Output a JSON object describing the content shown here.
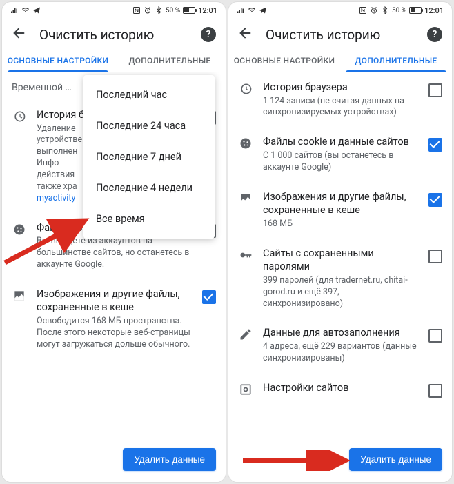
{
  "status": {
    "battery_pct": "50 %",
    "time": "12:01"
  },
  "header": {
    "title": "Очистить историю",
    "help": "?"
  },
  "tabs": {
    "basic": "ОСНОВНЫЕ НАСТРОЙКИ",
    "advanced": "ДОПОЛНИТЕЛЬНЫЕ"
  },
  "left": {
    "time_range_label": "Временной д…",
    "time_range_value": "Последний час",
    "menu": [
      "Последний час",
      "Последние 24 часа",
      "Последние 7 дней",
      "Последние 4 недели",
      "Все время"
    ],
    "items": [
      {
        "title": "История браузера",
        "sub_pre": "Удаление\nустройстве\nвыполнен\nИнфо\nдействия\nтакже хра\n",
        "sub_link": "myactivity",
        "checked": false
      },
      {
        "title": "Файлы cookie и данные сайтов",
        "sub": "Вы выйдете из аккаунтов на большинстве сайтов, но останетесь в аккаунте Google.",
        "checked": false
      },
      {
        "title": "Изображения и другие файлы, сохраненные в кеше",
        "sub": "Освободится 168 МБ пространства. После этого некоторые веб-страницы могут загружаться дольше обычного.",
        "checked": true
      }
    ]
  },
  "right": {
    "items": [
      {
        "title": "История браузера",
        "sub": "1 124 записи (не считая данных на синхронизируемых устройствах)",
        "checked": false
      },
      {
        "title": "Файлы cookie и данные сайтов",
        "sub": "С 1 000 сайтов (вы останетесь в аккаунте Google)",
        "checked": true
      },
      {
        "title": "Изображения и другие файлы, сохраненные в кеше",
        "sub": "168 МБ",
        "checked": true
      },
      {
        "title": "Сайты с сохраненными паролями",
        "sub": "399 паролей (для tradernet.ru, chitai-gorod.ru и ещё 397, синхронизировано)",
        "checked": false
      },
      {
        "title": "Данные для автозаполнения",
        "sub": "4 адреса, ещё 229 вариантов (данные синхронизированы)",
        "checked": false
      },
      {
        "title": "Настройки сайтов",
        "sub": "",
        "checked": false
      }
    ]
  },
  "button": "Удалить данные"
}
